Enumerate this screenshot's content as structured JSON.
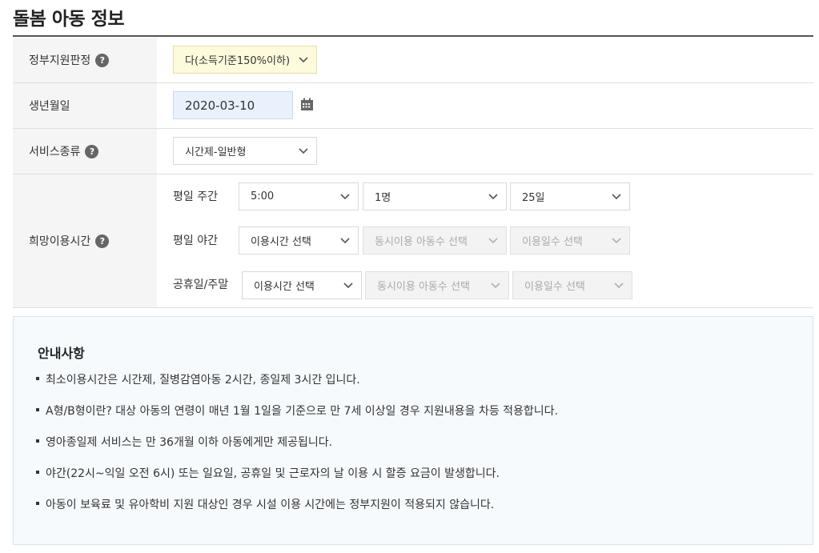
{
  "page_title": "돌봄 아동 정보",
  "form": {
    "gov_support": {
      "label": "정부지원판정",
      "value": "다(소득기준150%이하)"
    },
    "birth_date": {
      "label": "생년월일",
      "value": "2020-03-10"
    },
    "service_type": {
      "label": "서비스종류",
      "value": "시간제-일반형"
    },
    "desired_time": {
      "label": "희망이용시간",
      "rows": [
        {
          "label": "평일 주간",
          "time": "5:00",
          "children": "1명",
          "days": "25일"
        },
        {
          "label": "평일 야간",
          "time": "이용시간 선택",
          "children": "동시이용 아동수 선택",
          "days": "이용일수 선택"
        },
        {
          "label": "공휴일/주말",
          "time": "이용시간 선택",
          "children": "동시이용 아동수 선택",
          "days": "이용일수 선택"
        }
      ]
    },
    "help_glyph": "?"
  },
  "notice": {
    "title": "안내사항",
    "items": [
      "최소이용시간은 시간제, 질병감염아동 2시간, 종일제 3시간 입니다.",
      "A형/B형이란? 대상 아동의 연령이 매년 1월 1일을 기준으로 만 7세 이상일 경우 지원내용을 차등 적용합니다.",
      "영아종일제 서비스는 만 36개월 이하 아동에게만 제공됩니다.",
      "야간(22시~익일 오전 6시) 또는 일요일, 공휴일 및 근로자의 날 이용 시 할증 요금이 발생합니다.",
      "아동이 보육료 및 유아학비 지원 대상인 경우 시설 이용 시간에는 정부지원이 적용되지 않습니다."
    ]
  },
  "colors": {
    "highlight_field": "#fdfbdc",
    "date_field": "#e9f1fc",
    "label_bg": "#f5f5f5",
    "notice_bg": "#f6fafd"
  },
  "icons": {
    "help": "help-icon",
    "calendar": "calendar-icon",
    "dropdown": "chevron-down-icon"
  }
}
